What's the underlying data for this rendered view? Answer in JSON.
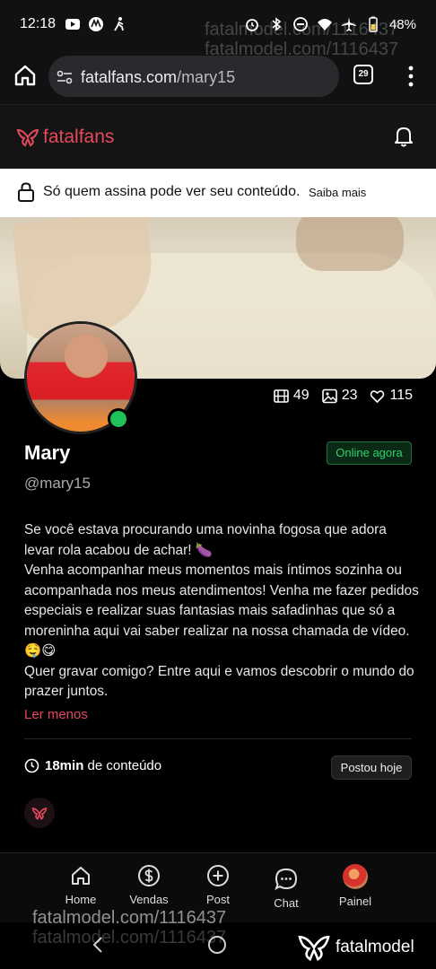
{
  "status_bar": {
    "time": "12:18",
    "battery": "48%"
  },
  "browser": {
    "url_domain": "fatalfans.com",
    "url_path": "/mary15",
    "tab_count": "29"
  },
  "app": {
    "brand": "fatalfans",
    "brand_color": "#e4495d"
  },
  "banner": {
    "message": "Só quem assina pode ver seu conteúdo.",
    "link": "Saiba mais"
  },
  "profile": {
    "name": "Mary",
    "handle": "@mary15",
    "status": "Online agora",
    "stats": {
      "videos": "49",
      "photos": "23",
      "likes": "115"
    },
    "bio_lines": [
      "Se você estava procurando uma novinha fogosa que adora levar rola acabou de achar! 🍆",
      "Venha acompanhar meus momentos mais íntimos sozinha ou acompanhada nos meus atendimentos! Venha me fazer pedidos especiais e realizar suas fantasias mais safadinhas que só a moreninha aqui vai saber realizar na nossa chamada de vídeo.🤤😋",
      "Quer gravar comigo? Entre aqui e vamos descobrir o mundo do prazer juntos."
    ],
    "read_less": "Ler menos",
    "content_duration": "18min",
    "content_suffix": "de conteúdo",
    "posted": "Postou hoje"
  },
  "bottom_nav": [
    {
      "label": "Home",
      "icon": "home-icon"
    },
    {
      "label": "Vendas",
      "icon": "dollar-icon"
    },
    {
      "label": "Post",
      "icon": "plus-circle-icon"
    },
    {
      "label": "Chat",
      "icon": "chat-icon"
    },
    {
      "label": "Painel",
      "icon": "avatar"
    }
  ],
  "watermark": {
    "text": "fatalmodel.com/1116437",
    "brand": "fatalmodel"
  }
}
